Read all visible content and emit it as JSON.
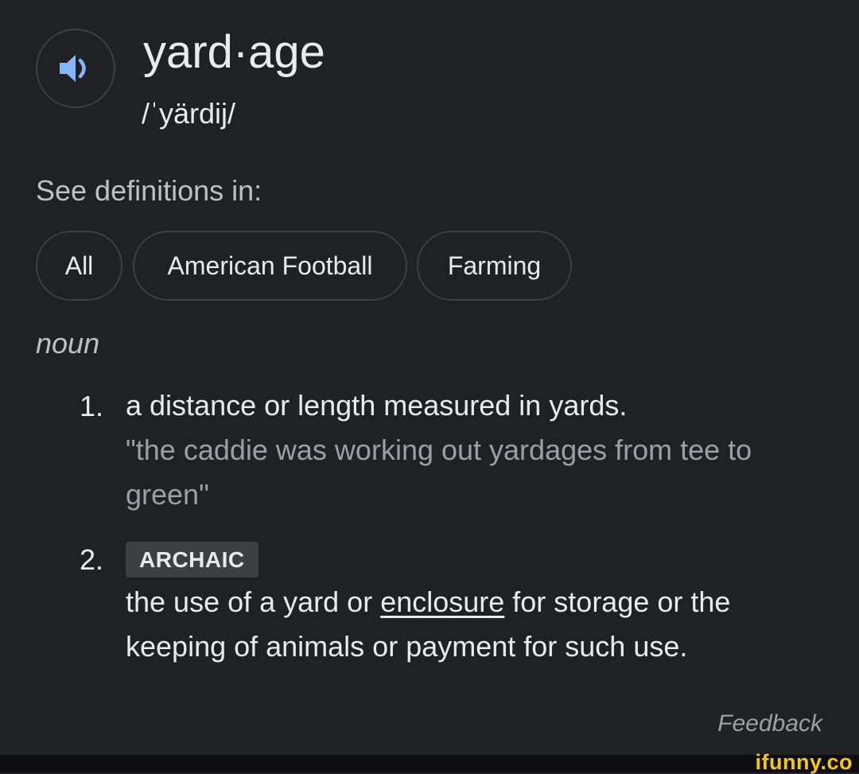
{
  "entry": {
    "word": "yard·age",
    "phonetic": "/ˈyärdij/",
    "speaker_icon": "speaker-icon"
  },
  "see_definitions": {
    "label": "See definitions in:",
    "chips": [
      "All",
      "American Football",
      "Farming"
    ]
  },
  "part_of_speech": "noun",
  "definitions": [
    {
      "number": "1.",
      "text": "a distance or length measured in yards.",
      "example": "\"the caddie was working out yardages from tee to green\""
    },
    {
      "number": "2.",
      "tag": "ARCHAIC",
      "text_before": "the use of a yard or ",
      "link": "enclosure",
      "text_after": " for storage or the keeping of animals or payment for such use."
    }
  ],
  "feedback_label": "Feedback",
  "watermark": "ifunny.co",
  "colors": {
    "background": "#202124",
    "text": "#e8eaed",
    "muted": "#9aa0a6",
    "speaker_accent": "#8ab4f8",
    "watermark": "#f5c518"
  }
}
